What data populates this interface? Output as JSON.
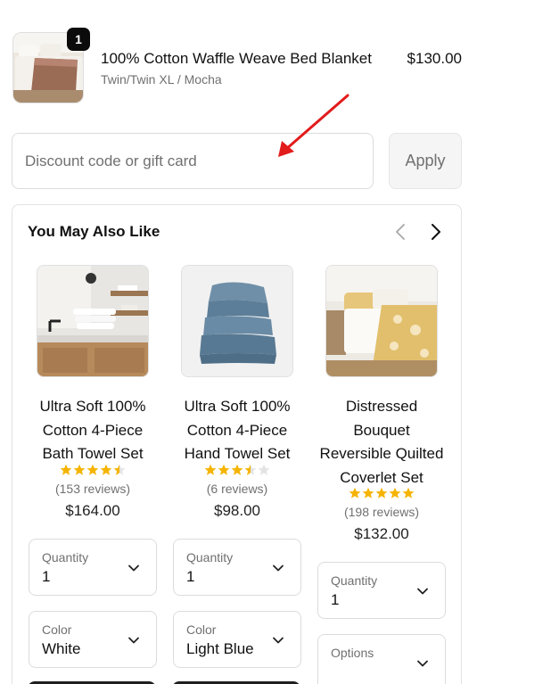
{
  "cart_line": {
    "quantity": "1",
    "title": "100% Cotton Waffle Weave Bed Blanket",
    "variant": "Twin/Twin XL / Mocha",
    "price": "$130.00"
  },
  "discount": {
    "placeholder": "Discount code or gift card",
    "apply_label": "Apply"
  },
  "upsell": {
    "title": "You May Also Like",
    "products": [
      {
        "name": "Ultra Soft 100% Cotton 4-Piece Bath Towel Set",
        "rating": 4.5,
        "reviews": "(153 reviews)",
        "price": "$164.00",
        "quantity_label": "Quantity",
        "quantity_value": "1",
        "option_label": "Color",
        "option_value": "White"
      },
      {
        "name": "Ultra Soft 100% Cotton 4-Piece Hand Towel Set",
        "rating": 3.5,
        "reviews": "(6 reviews)",
        "price": "$98.00",
        "quantity_label": "Quantity",
        "quantity_value": "1",
        "option_label": "Color",
        "option_value": "Light Blue"
      },
      {
        "name": "Distressed Bouquet Reversible Quilted Coverlet Set",
        "rating": 5,
        "reviews": "(198 reviews)",
        "price": "$132.00",
        "quantity_label": "Quantity",
        "quantity_value": "1",
        "option_label": "Options",
        "option_value": ""
      }
    ]
  },
  "colors": {
    "star": "#f5b400",
    "star_empty": "#e3e3e3",
    "arrow": "#e21b1b",
    "badge": "#0b0b0b"
  },
  "icons": {
    "prev": "chevron-left-icon",
    "next": "chevron-right-icon",
    "dropdown": "chevron-down-icon"
  }
}
